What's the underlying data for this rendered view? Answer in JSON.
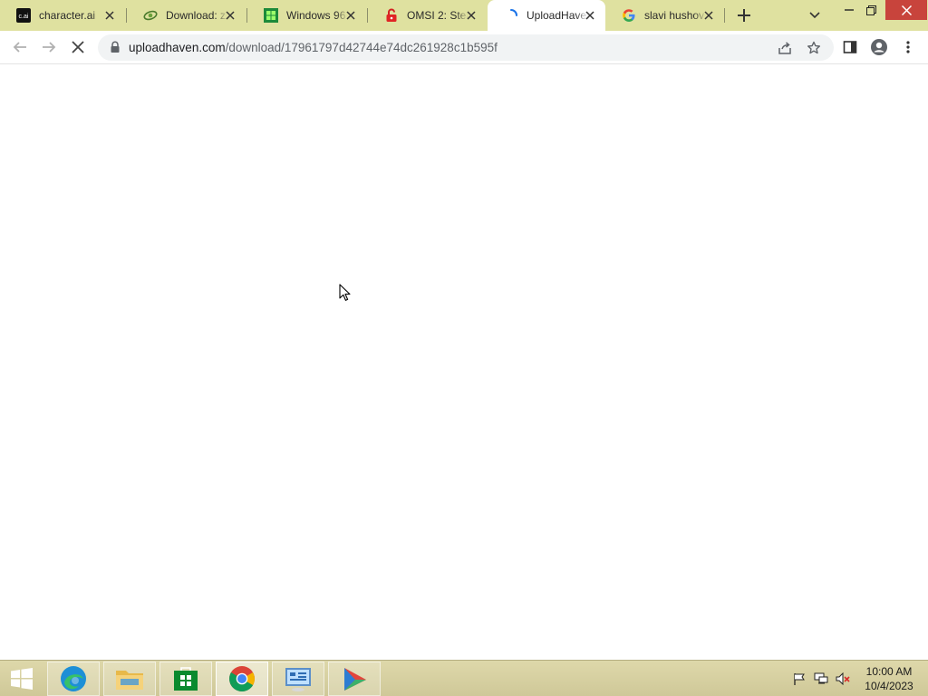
{
  "browser": {
    "tabs": [
      {
        "title": "character.ai",
        "favicon": "character-ai-icon",
        "active": false
      },
      {
        "title": "Download: z",
        "favicon": "download-site-icon",
        "active": false
      },
      {
        "title": "Windows 96",
        "favicon": "windows96-icon",
        "active": false
      },
      {
        "title": "OMSI 2: Stea",
        "favicon": "unlock-icon",
        "active": false
      },
      {
        "title": "UploadHave",
        "favicon": "loading-spinner-icon",
        "active": true
      },
      {
        "title": "slavi hushov",
        "favicon": "google-icon",
        "active": false
      }
    ],
    "url": {
      "host": "uploadhaven.com",
      "path": "/download/17961797d42744e74dc261928c1b595f"
    },
    "colors": {
      "tab_strip": "#dfe1a0",
      "active_tab": "#ffffff",
      "close_button": "#c8443c"
    }
  },
  "taskbar": {
    "apps": [
      {
        "name": "Microsoft Edge",
        "icon": "edge-icon"
      },
      {
        "name": "File Explorer",
        "icon": "folder-icon"
      },
      {
        "name": "Microsoft Store",
        "icon": "store-icon"
      },
      {
        "name": "Google Chrome",
        "icon": "chrome-icon",
        "active": true
      },
      {
        "name": "Control Panel",
        "icon": "control-panel-icon"
      },
      {
        "name": "Media Player",
        "icon": "media-player-icon"
      }
    ],
    "tray": {
      "icons": [
        "action-center-flag-icon",
        "network-icon",
        "volume-muted-icon"
      ],
      "time": "10:00 AM",
      "date": "10/4/2023"
    }
  }
}
